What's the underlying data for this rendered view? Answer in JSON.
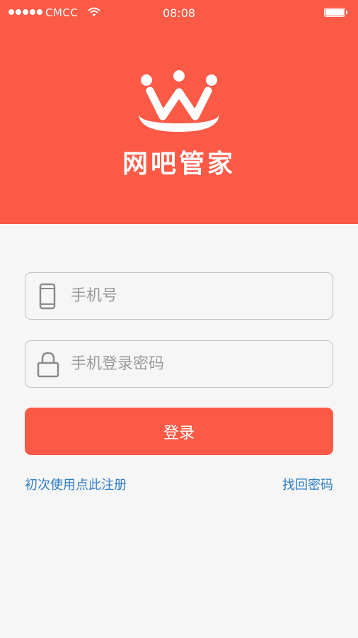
{
  "status_bar": {
    "carrier": "CMCC",
    "time": "08:08",
    "icons": [
      "signal-dots-icon",
      "wifi-icon",
      "battery-icon"
    ]
  },
  "header": {
    "app_name": "网吧管家",
    "background_color": "#fb5a46",
    "logo": "crown-w-logo"
  },
  "form": {
    "phone": {
      "placeholder": "手机号",
      "value": "",
      "icon": "mobile-phone-icon"
    },
    "password": {
      "placeholder": "手机登录密码",
      "value": "",
      "icon": "lock-icon"
    },
    "login_label": "登录"
  },
  "links": {
    "register": "初次使用点此注册",
    "forgot_password": "找回密码",
    "link_color": "#2f7dc6"
  }
}
